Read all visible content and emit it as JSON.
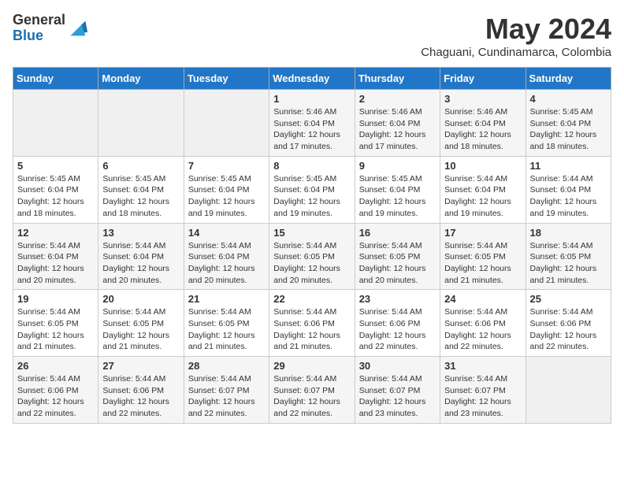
{
  "header": {
    "logo_general": "General",
    "logo_blue": "Blue",
    "month_title": "May 2024",
    "location": "Chaguani, Cundinamarca, Colombia"
  },
  "days_of_week": [
    "Sunday",
    "Monday",
    "Tuesday",
    "Wednesday",
    "Thursday",
    "Friday",
    "Saturday"
  ],
  "weeks": [
    [
      {
        "day": "",
        "info": ""
      },
      {
        "day": "",
        "info": ""
      },
      {
        "day": "",
        "info": ""
      },
      {
        "day": "1",
        "info": "Sunrise: 5:46 AM\nSunset: 6:04 PM\nDaylight: 12 hours\nand 17 minutes."
      },
      {
        "day": "2",
        "info": "Sunrise: 5:46 AM\nSunset: 6:04 PM\nDaylight: 12 hours\nand 17 minutes."
      },
      {
        "day": "3",
        "info": "Sunrise: 5:46 AM\nSunset: 6:04 PM\nDaylight: 12 hours\nand 18 minutes."
      },
      {
        "day": "4",
        "info": "Sunrise: 5:45 AM\nSunset: 6:04 PM\nDaylight: 12 hours\nand 18 minutes."
      }
    ],
    [
      {
        "day": "5",
        "info": "Sunrise: 5:45 AM\nSunset: 6:04 PM\nDaylight: 12 hours\nand 18 minutes."
      },
      {
        "day": "6",
        "info": "Sunrise: 5:45 AM\nSunset: 6:04 PM\nDaylight: 12 hours\nand 18 minutes."
      },
      {
        "day": "7",
        "info": "Sunrise: 5:45 AM\nSunset: 6:04 PM\nDaylight: 12 hours\nand 19 minutes."
      },
      {
        "day": "8",
        "info": "Sunrise: 5:45 AM\nSunset: 6:04 PM\nDaylight: 12 hours\nand 19 minutes."
      },
      {
        "day": "9",
        "info": "Sunrise: 5:45 AM\nSunset: 6:04 PM\nDaylight: 12 hours\nand 19 minutes."
      },
      {
        "day": "10",
        "info": "Sunrise: 5:44 AM\nSunset: 6:04 PM\nDaylight: 12 hours\nand 19 minutes."
      },
      {
        "day": "11",
        "info": "Sunrise: 5:44 AM\nSunset: 6:04 PM\nDaylight: 12 hours\nand 19 minutes."
      }
    ],
    [
      {
        "day": "12",
        "info": "Sunrise: 5:44 AM\nSunset: 6:04 PM\nDaylight: 12 hours\nand 20 minutes."
      },
      {
        "day": "13",
        "info": "Sunrise: 5:44 AM\nSunset: 6:04 PM\nDaylight: 12 hours\nand 20 minutes."
      },
      {
        "day": "14",
        "info": "Sunrise: 5:44 AM\nSunset: 6:04 PM\nDaylight: 12 hours\nand 20 minutes."
      },
      {
        "day": "15",
        "info": "Sunrise: 5:44 AM\nSunset: 6:05 PM\nDaylight: 12 hours\nand 20 minutes."
      },
      {
        "day": "16",
        "info": "Sunrise: 5:44 AM\nSunset: 6:05 PM\nDaylight: 12 hours\nand 20 minutes."
      },
      {
        "day": "17",
        "info": "Sunrise: 5:44 AM\nSunset: 6:05 PM\nDaylight: 12 hours\nand 21 minutes."
      },
      {
        "day": "18",
        "info": "Sunrise: 5:44 AM\nSunset: 6:05 PM\nDaylight: 12 hours\nand 21 minutes."
      }
    ],
    [
      {
        "day": "19",
        "info": "Sunrise: 5:44 AM\nSunset: 6:05 PM\nDaylight: 12 hours\nand 21 minutes."
      },
      {
        "day": "20",
        "info": "Sunrise: 5:44 AM\nSunset: 6:05 PM\nDaylight: 12 hours\nand 21 minutes."
      },
      {
        "day": "21",
        "info": "Sunrise: 5:44 AM\nSunset: 6:05 PM\nDaylight: 12 hours\nand 21 minutes."
      },
      {
        "day": "22",
        "info": "Sunrise: 5:44 AM\nSunset: 6:06 PM\nDaylight: 12 hours\nand 21 minutes."
      },
      {
        "day": "23",
        "info": "Sunrise: 5:44 AM\nSunset: 6:06 PM\nDaylight: 12 hours\nand 22 minutes."
      },
      {
        "day": "24",
        "info": "Sunrise: 5:44 AM\nSunset: 6:06 PM\nDaylight: 12 hours\nand 22 minutes."
      },
      {
        "day": "25",
        "info": "Sunrise: 5:44 AM\nSunset: 6:06 PM\nDaylight: 12 hours\nand 22 minutes."
      }
    ],
    [
      {
        "day": "26",
        "info": "Sunrise: 5:44 AM\nSunset: 6:06 PM\nDaylight: 12 hours\nand 22 minutes."
      },
      {
        "day": "27",
        "info": "Sunrise: 5:44 AM\nSunset: 6:06 PM\nDaylight: 12 hours\nand 22 minutes."
      },
      {
        "day": "28",
        "info": "Sunrise: 5:44 AM\nSunset: 6:07 PM\nDaylight: 12 hours\nand 22 minutes."
      },
      {
        "day": "29",
        "info": "Sunrise: 5:44 AM\nSunset: 6:07 PM\nDaylight: 12 hours\nand 22 minutes."
      },
      {
        "day": "30",
        "info": "Sunrise: 5:44 AM\nSunset: 6:07 PM\nDaylight: 12 hours\nand 23 minutes."
      },
      {
        "day": "31",
        "info": "Sunrise: 5:44 AM\nSunset: 6:07 PM\nDaylight: 12 hours\nand 23 minutes."
      },
      {
        "day": "",
        "info": ""
      }
    ]
  ]
}
